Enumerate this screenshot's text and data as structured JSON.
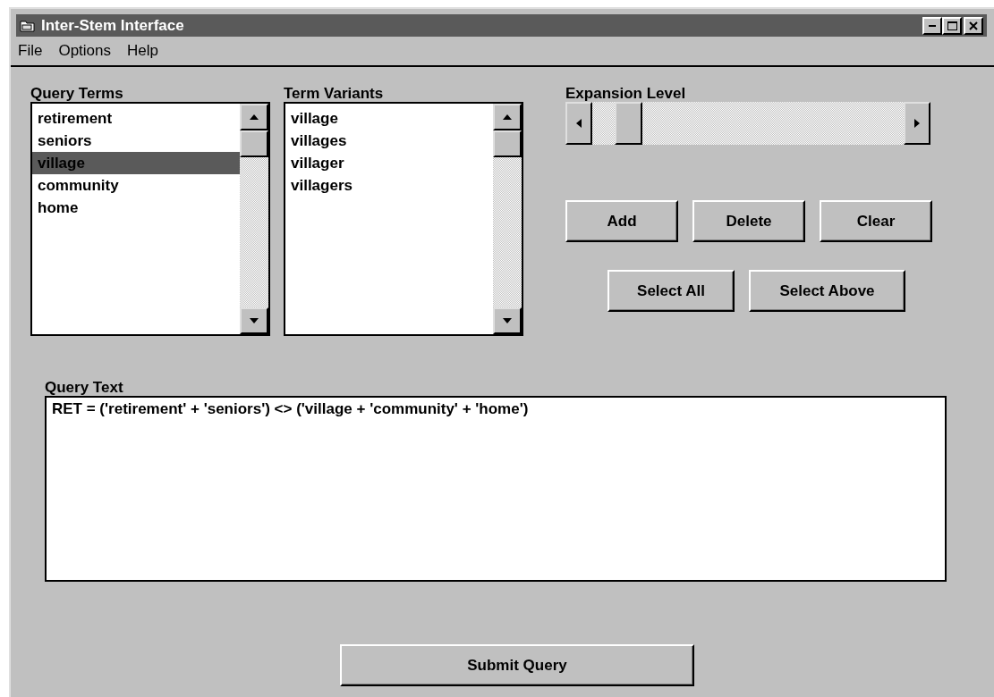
{
  "window": {
    "title": "Inter-Stem Interface"
  },
  "menu": [
    {
      "label": "File"
    },
    {
      "label": "Options"
    },
    {
      "label": "Help"
    }
  ],
  "query_terms": {
    "label": "Query Terms",
    "items": [
      {
        "text": "retirement",
        "selected": false
      },
      {
        "text": "seniors",
        "selected": false
      },
      {
        "text": "village",
        "selected": true
      },
      {
        "text": "community",
        "selected": false
      },
      {
        "text": "home",
        "selected": false
      }
    ]
  },
  "term_variants": {
    "label": "Term Variants",
    "items": [
      {
        "text": "village",
        "selected": false
      },
      {
        "text": "villages",
        "selected": false
      },
      {
        "text": "villager",
        "selected": false
      },
      {
        "text": "villagers",
        "selected": false
      }
    ]
  },
  "expansion_level": {
    "label": "Expansion Level",
    "level": 0.08
  },
  "buttons_row1": [
    {
      "label": "Add"
    },
    {
      "label": "Delete"
    },
    {
      "label": "Clear"
    }
  ],
  "buttons_row2": [
    {
      "label": "Select All"
    },
    {
      "label": "Select Above"
    }
  ],
  "query_text": {
    "label": "Query Text",
    "value": "RET = ('retirement' + 'seniors') <> ('village + 'community' + 'home')"
  },
  "submit": {
    "label": "Submit Query"
  }
}
